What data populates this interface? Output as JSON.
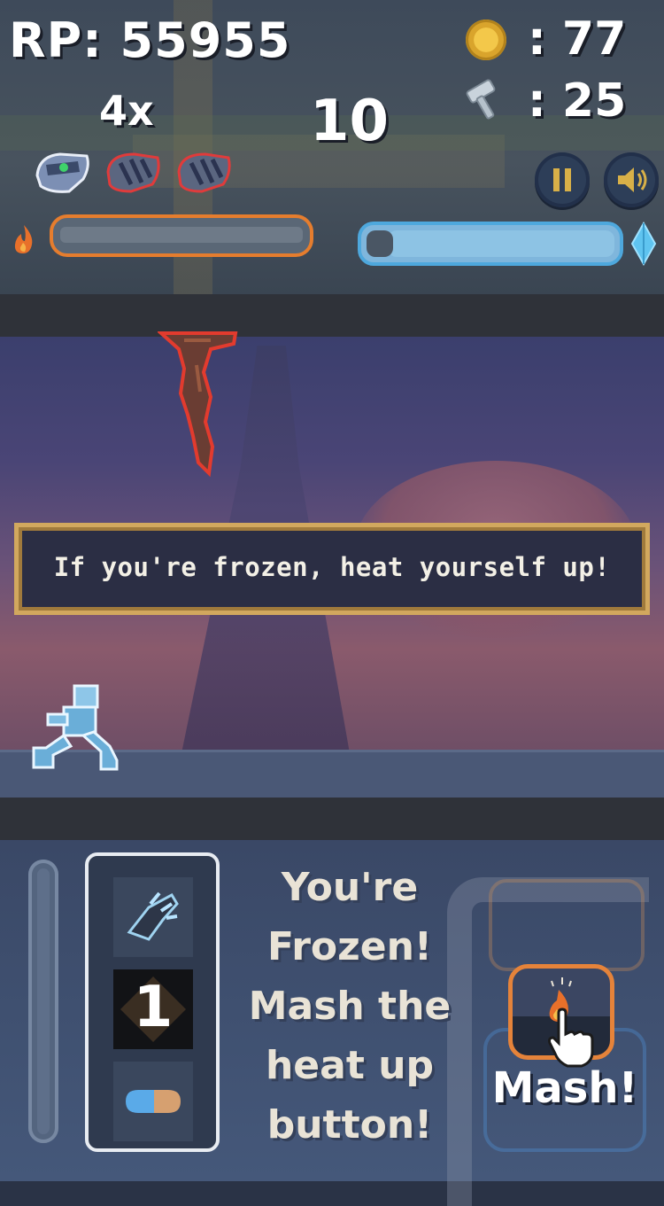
{
  "hud": {
    "rp_label": "RP: 55955",
    "multiplier": "4x",
    "counter": "10",
    "coins": ": 77",
    "hammers": ": 25",
    "icons": [
      "coin-icon",
      "hammer-icon",
      "helmet-icon",
      "glove-icon",
      "pause-icon",
      "sound-icon",
      "flame-icon",
      "crystal-icon"
    ]
  },
  "tutorial": {
    "message": "If you're frozen, heat yourself up!"
  },
  "panel": {
    "inventory_count": "1",
    "instructions": [
      "You're",
      "Frozen!",
      "Mash the",
      "heat up",
      "button!"
    ],
    "mash_label": "Mash!"
  },
  "colors": {
    "heat": "#e57d2e",
    "frost": "#4ea8dd",
    "tutorial_border": "#d2a85e"
  }
}
